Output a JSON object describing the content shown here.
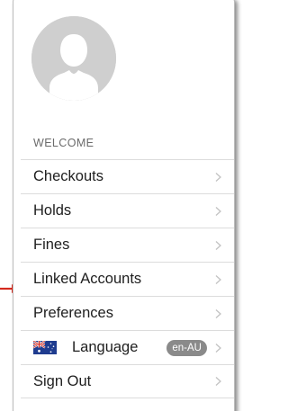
{
  "menu": {
    "section_label": "WELCOME",
    "items": [
      {
        "label": "Checkouts"
      },
      {
        "label": "Holds"
      },
      {
        "label": "Fines"
      },
      {
        "label": "Linked Accounts"
      },
      {
        "label": "Preferences"
      },
      {
        "label": "Language",
        "badge": "en-AU",
        "icon": "australia-flag-icon"
      },
      {
        "label": "Sign Out"
      }
    ]
  },
  "colors": {
    "pointer_arrow": "#d42a1e",
    "avatar_bg": "#cfcfcf",
    "avatar_silhouette": "#ffffff",
    "badge_bg": "#8a8a8a"
  }
}
